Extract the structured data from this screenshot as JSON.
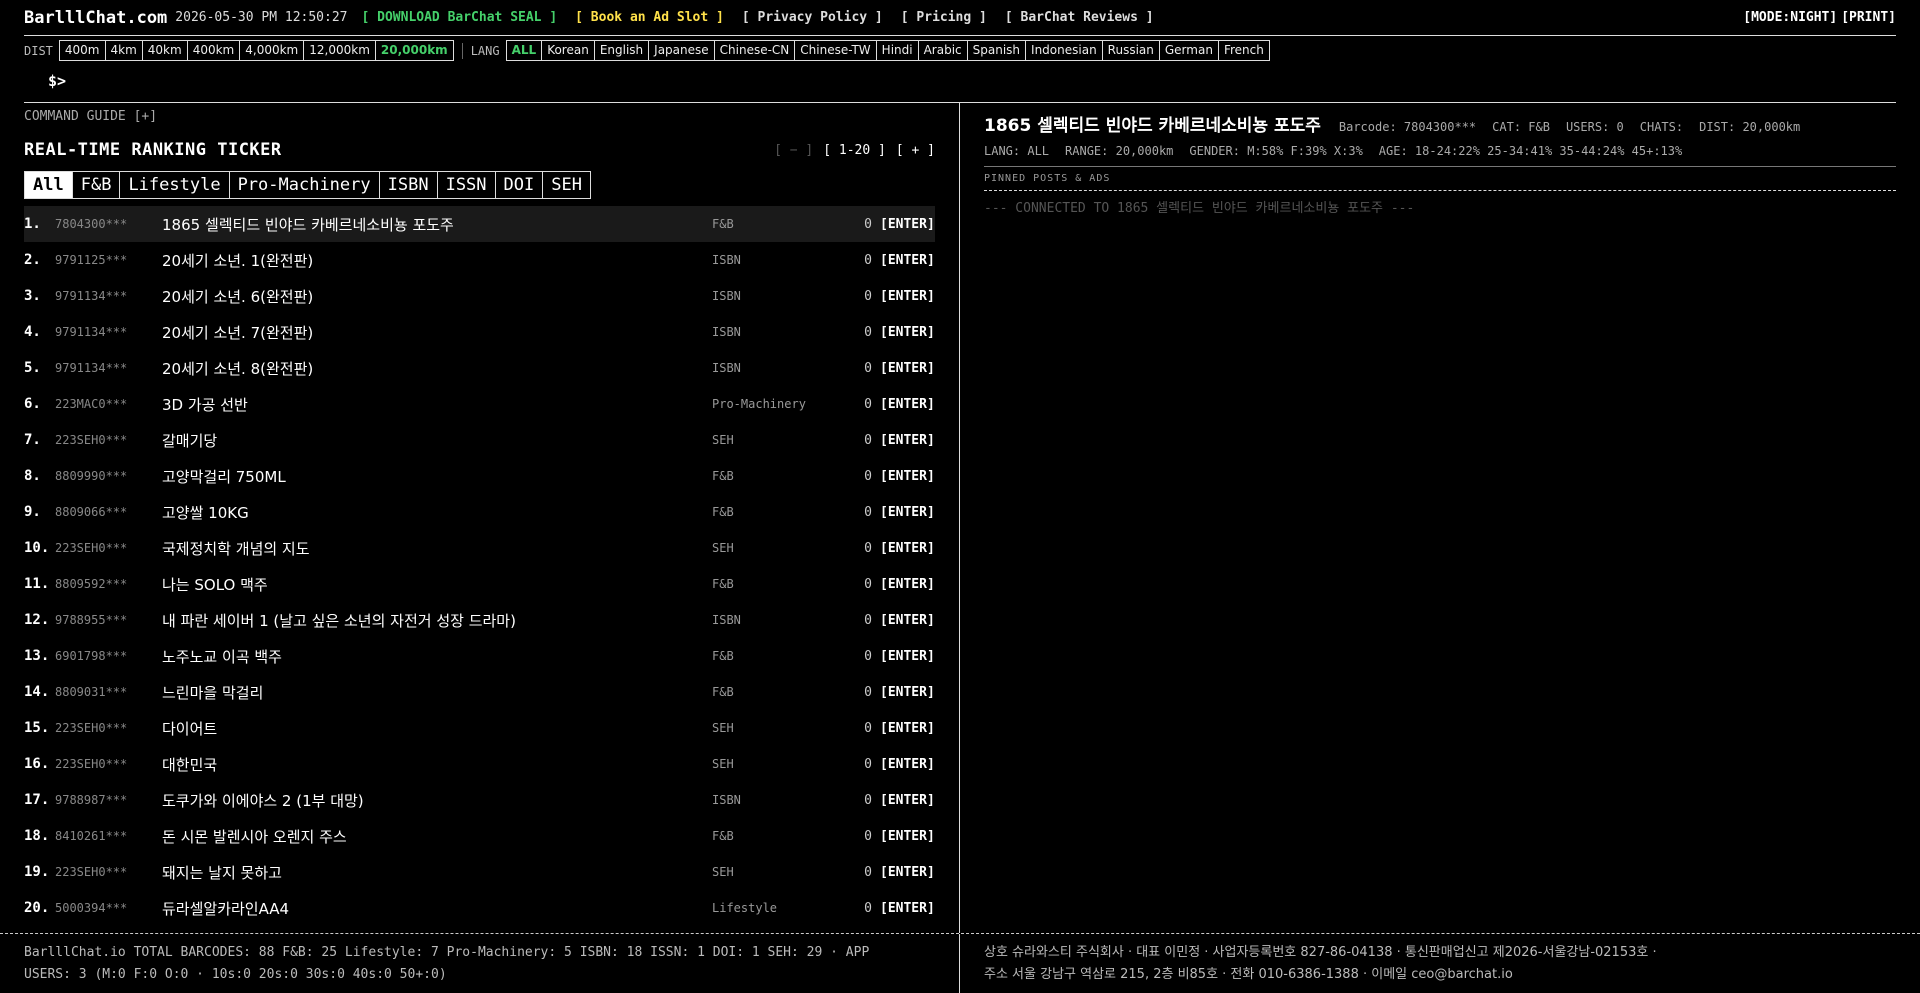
{
  "topbar": {
    "logo": "BarlllChat.com",
    "datetime": "2026-05-30 PM 12:50:27",
    "links": [
      {
        "label": "[ DOWNLOAD BarChat SEAL ]",
        "color": "green"
      },
      {
        "label": "[ Book an Ad Slot ]",
        "color": "yellow"
      },
      {
        "label": "[ Privacy Policy ]",
        "color": "white"
      },
      {
        "label": "[ Pricing ]",
        "color": "white"
      },
      {
        "label": "[ BarChat Reviews ]",
        "color": "white"
      }
    ],
    "mode": "[MODE:NIGHT]",
    "print": "[PRINT]"
  },
  "filters": {
    "dist_label": "DIST",
    "dist": [
      "400m",
      "4km",
      "40km",
      "400km",
      "4,000km",
      "12,000km",
      "20,000km"
    ],
    "dist_active": "20,000km",
    "lang_label": "LANG",
    "lang": [
      "ALL",
      "Korean",
      "English",
      "Japanese",
      "Chinese-CN",
      "Chinese-TW",
      "Hindi",
      "Arabic",
      "Spanish",
      "Indonesian",
      "Russian",
      "German",
      "French"
    ],
    "lang_active": "ALL"
  },
  "prompt": "$>",
  "left": {
    "command_guide": "COMMAND GUIDE [+]",
    "title": "REAL-TIME RANKING TICKER",
    "pager": {
      "prev": "[ − ]",
      "range": "[ 1-20 ]",
      "next": "[ + ]"
    },
    "tabs": [
      "All",
      "F&B",
      "Lifestyle",
      "Pro-Machinery",
      "ISBN",
      "ISSN",
      "DOI",
      "SEH"
    ],
    "tab_active": "All",
    "enter_label": "[ENTER]",
    "rows": [
      {
        "rank": "1.",
        "code": "7804300***",
        "name": "1865 셀렉티드 빈야드 카베르네소비뇽 포도주",
        "cat": "F&B",
        "count": "0"
      },
      {
        "rank": "2.",
        "code": "9791125***",
        "name": "20세기 소년. 1(완전판)",
        "cat": "ISBN",
        "count": "0"
      },
      {
        "rank": "3.",
        "code": "9791134***",
        "name": "20세기 소년. 6(완전판)",
        "cat": "ISBN",
        "count": "0"
      },
      {
        "rank": "4.",
        "code": "9791134***",
        "name": "20세기 소년. 7(완전판)",
        "cat": "ISBN",
        "count": "0"
      },
      {
        "rank": "5.",
        "code": "9791134***",
        "name": "20세기 소년. 8(완전판)",
        "cat": "ISBN",
        "count": "0"
      },
      {
        "rank": "6.",
        "code": "223MAC0***",
        "name": "3D 가공 선반",
        "cat": "Pro-Machinery",
        "count": "0"
      },
      {
        "rank": "7.",
        "code": "223SEH0***",
        "name": "갈매기당",
        "cat": "SEH",
        "count": "0"
      },
      {
        "rank": "8.",
        "code": "8809990***",
        "name": "고양막걸리 750ML",
        "cat": "F&B",
        "count": "0"
      },
      {
        "rank": "9.",
        "code": "8809066***",
        "name": "고양쌀 10KG",
        "cat": "F&B",
        "count": "0"
      },
      {
        "rank": "10.",
        "code": "223SEH0***",
        "name": "국제정치학 개념의 지도",
        "cat": "SEH",
        "count": "0"
      },
      {
        "rank": "11.",
        "code": "8809592***",
        "name": "나는 SOLO 맥주",
        "cat": "F&B",
        "count": "0"
      },
      {
        "rank": "12.",
        "code": "9788955***",
        "name": "내 파란 세이버 1 (날고 싶은 소년의 자전거 성장 드라마)",
        "cat": "ISBN",
        "count": "0"
      },
      {
        "rank": "13.",
        "code": "6901798***",
        "name": "노주노교 이곡 백주",
        "cat": "F&B",
        "count": "0"
      },
      {
        "rank": "14.",
        "code": "8809031***",
        "name": "느린마을 막걸리",
        "cat": "F&B",
        "count": "0"
      },
      {
        "rank": "15.",
        "code": "223SEH0***",
        "name": "다이어트",
        "cat": "SEH",
        "count": "0"
      },
      {
        "rank": "16.",
        "code": "223SEH0***",
        "name": "대한민국",
        "cat": "SEH",
        "count": "0"
      },
      {
        "rank": "17.",
        "code": "9788987***",
        "name": "도쿠가와 이에야스 2 (1부 대망)",
        "cat": "ISBN",
        "count": "0"
      },
      {
        "rank": "18.",
        "code": "8410261***",
        "name": "돈 시몬 발렌시아 오렌지 주스",
        "cat": "F&B",
        "count": "0"
      },
      {
        "rank": "19.",
        "code": "223SEH0***",
        "name": "돼지는 날지 못하고",
        "cat": "SEH",
        "count": "0"
      },
      {
        "rank": "20.",
        "code": "5000394***",
        "name": "듀라셀알카라인AA4",
        "cat": "Lifestyle",
        "count": "0"
      }
    ]
  },
  "right": {
    "title": "1865 셀렉티드 빈야드 카베르네소비뇽 포도주",
    "meta": [
      "Barcode: 7804300***",
      "CAT: F&B",
      "USERS: 0",
      "CHATS:",
      "DIST: 20,000km"
    ],
    "meta2": [
      "LANG: ALL",
      "RANGE: 20,000km",
      "GENDER: M:58% F:39% X:3%",
      "AGE: 18-24:22% 25-34:41% 35-44:24% 45+:13%"
    ],
    "pinned": "PINNED POSTS & ADS",
    "connected": "--- CONNECTED TO 1865 셀렉티드 빈야드 카베르네소비뇽 포도주 ---"
  },
  "footer": {
    "left_line1": "BarlllChat.io TOTAL BARCODES: 88 F&B: 25 Lifestyle: 7 Pro-Machinery: 5 ISBN: 18 ISSN: 1 DOI: 1 SEH: 29  ·  APP",
    "left_line2": "USERS: 3  (M:0 F:0 O:0 · 10s:0 20s:0 30s:0 40s:0 50+:0)",
    "right_line1": "상호 슈라와스티 주식회사 · 대표 이민정 · 사업자등록번호 827-86-04138 · 통신판매업신고 제2026-서울강남-02153호 ·",
    "right_line2": "주소 서울 강남구 역삼로 215, 2층 비85호 · 전화 010-6386-1388 · 이메일 ceo@barchat.io"
  },
  "colors": {
    "accent_green": "#45d06a",
    "accent_yellow": "#ffe14a",
    "background": "#000000"
  }
}
